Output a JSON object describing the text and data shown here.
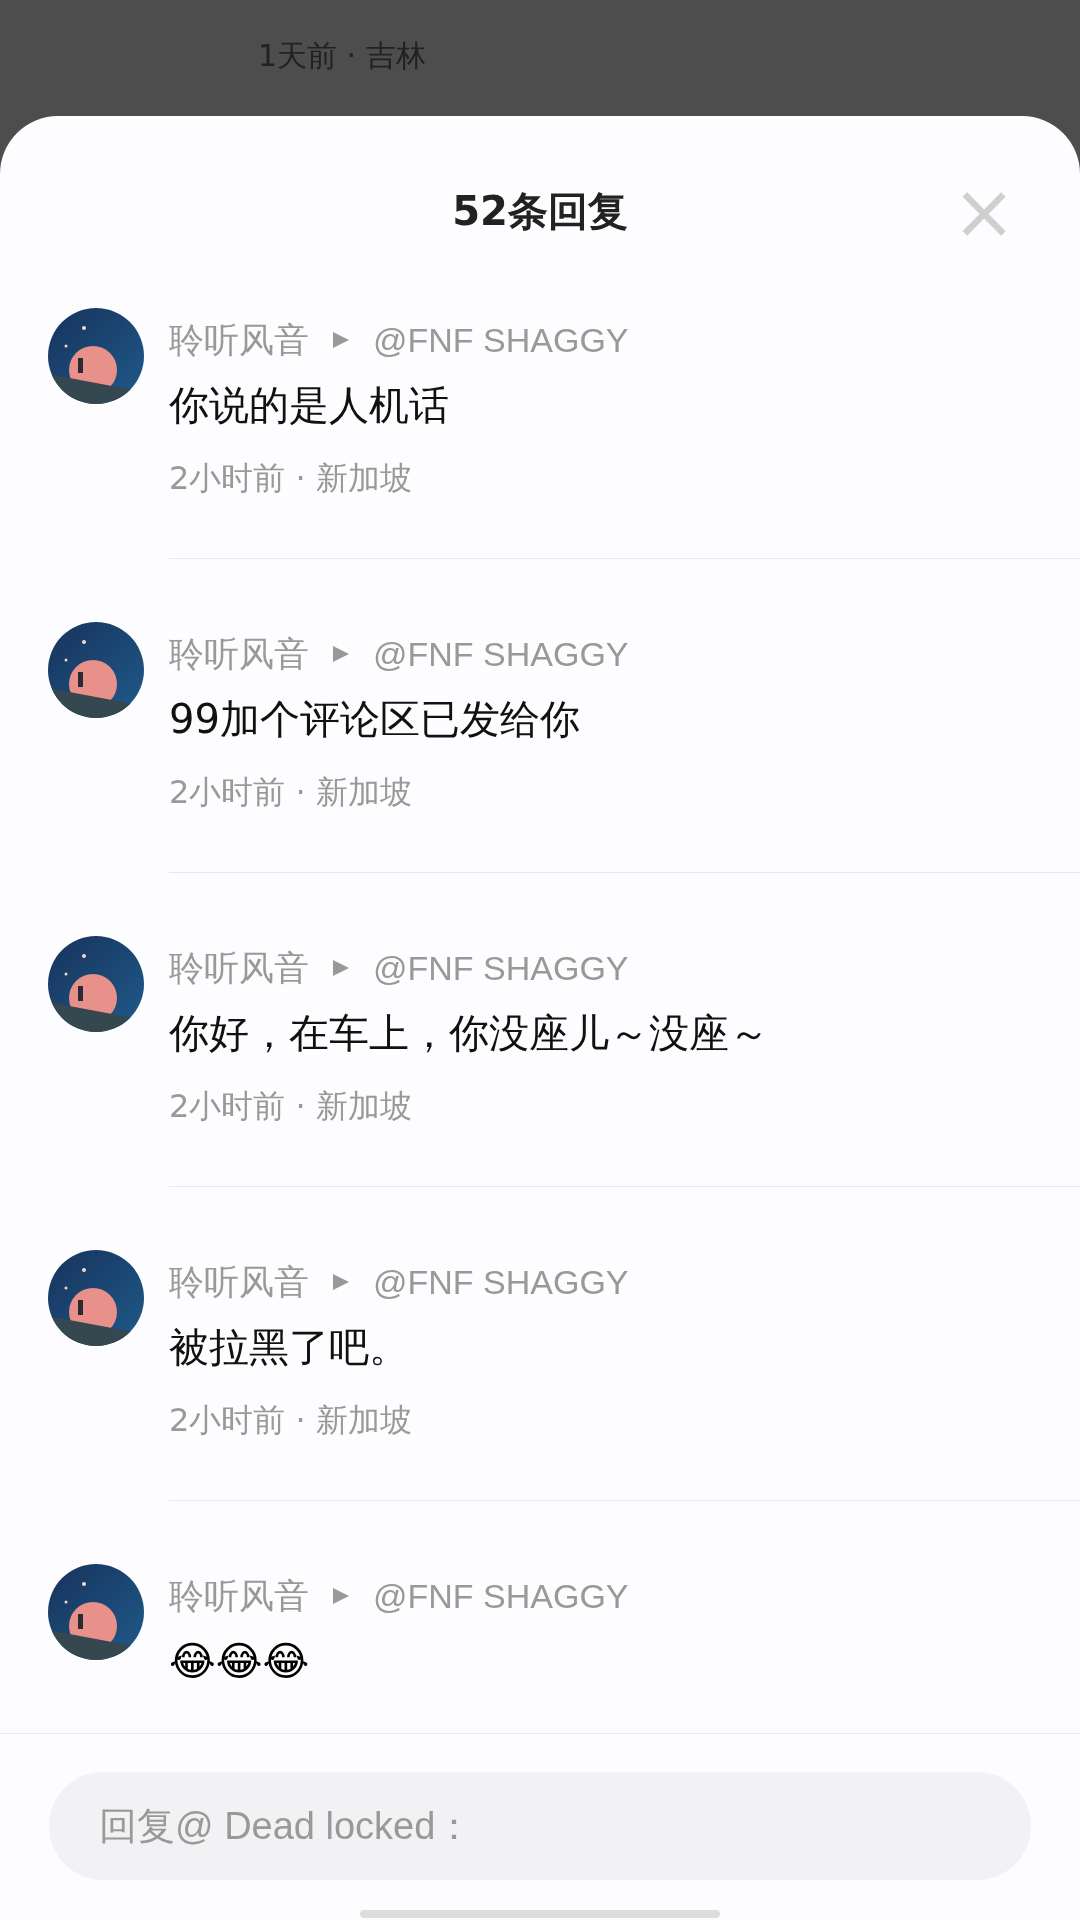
{
  "background": {
    "meta": "1天前 · 吉林"
  },
  "sheet": {
    "title": "52条回复",
    "close": "×"
  },
  "comments": [
    {
      "author": "聆听风音",
      "reply_to": "@FNF SHAGGY",
      "kind": "text",
      "content": "你说的是人机话",
      "meta": "2小时前 · 新加坡"
    },
    {
      "author": "聆听风音",
      "reply_to": "@FNF SHAGGY",
      "kind": "text",
      "content": "99加个评论区已发给你",
      "meta": "2小时前 · 新加坡"
    },
    {
      "author": "聆听风音",
      "reply_to": "@FNF SHAGGY",
      "kind": "text",
      "content": "你好，在车上，你没座儿～没座～",
      "meta": "2小时前 · 新加坡"
    },
    {
      "author": "聆听风音",
      "reply_to": "@FNF SHAGGY",
      "kind": "text",
      "content": "被拉黑了吧。",
      "meta": "2小时前 · 新加坡"
    },
    {
      "author": "聆听风音",
      "reply_to": "@FNF SHAGGY",
      "kind": "emoji",
      "content": "😂😂😂"
    }
  ],
  "reply_field": {
    "placeholder": "回复@ Dead locked："
  }
}
